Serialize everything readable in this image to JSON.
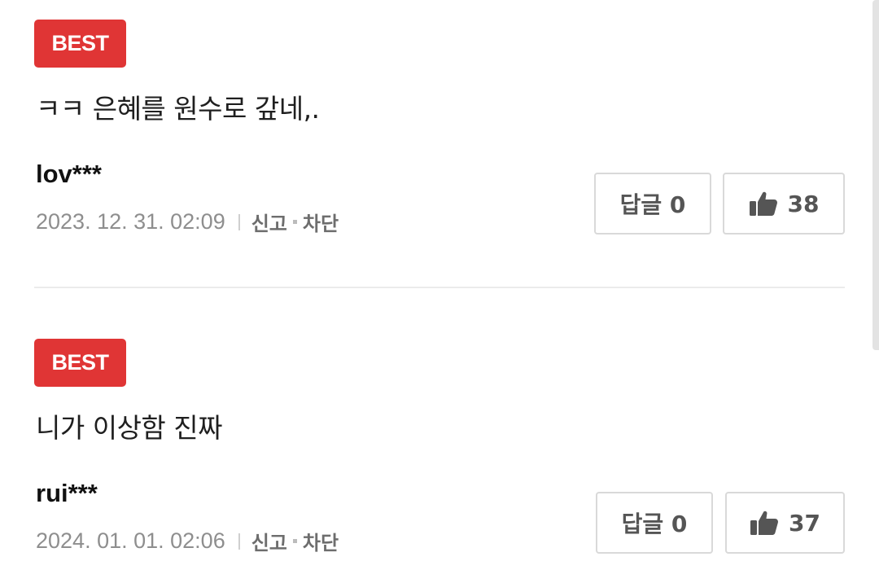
{
  "comments": [
    {
      "badge": "BEST",
      "text": "ㅋㅋ 은혜를 원수로 갚네,.",
      "author": "lov***",
      "date": "2023. 12. 31. 02:09",
      "report": "신고",
      "block": "차단",
      "reply_label": "답글 0",
      "likes": "38"
    },
    {
      "badge": "BEST",
      "text": "니가 이상함 진짜",
      "author": "rui***",
      "date": "2024. 01. 01. 02:06",
      "report": "신고",
      "block": "차단",
      "reply_label": "답글 0",
      "likes": "37"
    }
  ],
  "colors": {
    "badge": "#e03535",
    "text": "#1f1f1f",
    "meta": "#8e8e8e",
    "border": "#d9d9d9"
  }
}
